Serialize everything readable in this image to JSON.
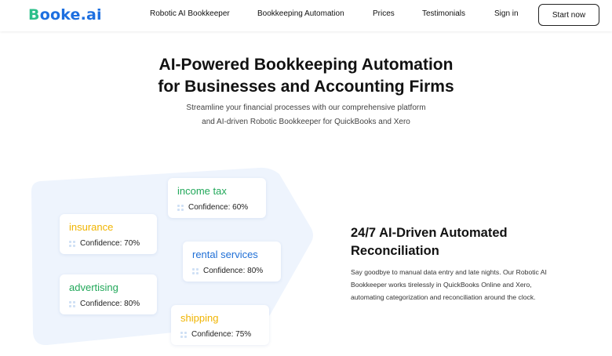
{
  "header": {
    "logo_main": "ooke.ai",
    "logo_initial": "B",
    "nav": [
      "Robotic AI Bookkeeper",
      "Bookkeeping Automation",
      "Prices",
      "Testimonials",
      "Sign in"
    ],
    "cta": "Start now"
  },
  "hero": {
    "title_line1": "AI-Powered Bookkeeping Automation",
    "title_line2": "for Businesses and Accounting Firms",
    "subtitle_line1": "Streamline your financial processes with our comprehensive platform",
    "subtitle_line2": "and AI-driven Robotic Bookkeeper for QuickBooks and Xero"
  },
  "cards": [
    {
      "tag": "income tax",
      "confidence": "Confidence: 60%",
      "color": "#22a85a"
    },
    {
      "tag": "insurance",
      "confidence": "Confidence: 70%",
      "color": "#f0b400"
    },
    {
      "tag": "rental services",
      "confidence": "Confidence: 80%",
      "color": "#1f6fd6"
    },
    {
      "tag": "advertising",
      "confidence": "Confidence: 80%",
      "color": "#22a85a"
    },
    {
      "tag": "shipping",
      "confidence": "Confidence: 75%",
      "color": "#f0b400"
    }
  ],
  "feature": {
    "title_line1": "24/7 AI-Driven Automated",
    "title_line2": "Reconciliation",
    "desc_line1": "Say goodbye to manual data entry and late nights. Our Robotic AI",
    "desc_line2": "Bookkeeper works tirelessly in QuickBooks Online and Xero,",
    "desc_line3": "automating categorization and reconciliation around the clock."
  },
  "colors": {
    "brand_blue": "#1d6fe0",
    "brand_green": "#2bbf8a",
    "blob": "#eef4fd"
  }
}
